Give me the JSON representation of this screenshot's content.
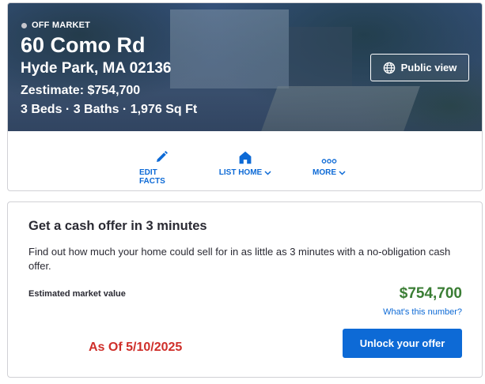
{
  "hero": {
    "status": "OFF MARKET",
    "street": "60 Como Rd",
    "city_line": "Hyde Park, MA 02136",
    "zestimate": "Zestimate: $754,700",
    "facts": "3 Beds · 3 Baths · 1,976 Sq Ft",
    "public_view_label": "Public view",
    "public_view_icon": "globe-icon"
  },
  "actions": [
    {
      "label": "EDIT FACTS",
      "icon": "pencil-icon"
    },
    {
      "label": "LIST HOME",
      "icon": "house-icon"
    },
    {
      "label": "MORE",
      "icon": "more-icon"
    }
  ],
  "cash_offer": {
    "title": "Get a cash offer in 3 minutes",
    "description": "Find out how much your home could sell for in as little as 3 minutes with a no-obligation cash offer.",
    "estimated_label": "Estimated market value",
    "estimated_value": "$754,700",
    "what_link": "What's this number?",
    "as_of": "As Of 5/10/2025",
    "unlock_label": "Unlock your offer"
  },
  "colors": {
    "accent": "#0d6ad6",
    "value_green": "#3a7d34",
    "as_of_red": "#cf2f2a"
  }
}
